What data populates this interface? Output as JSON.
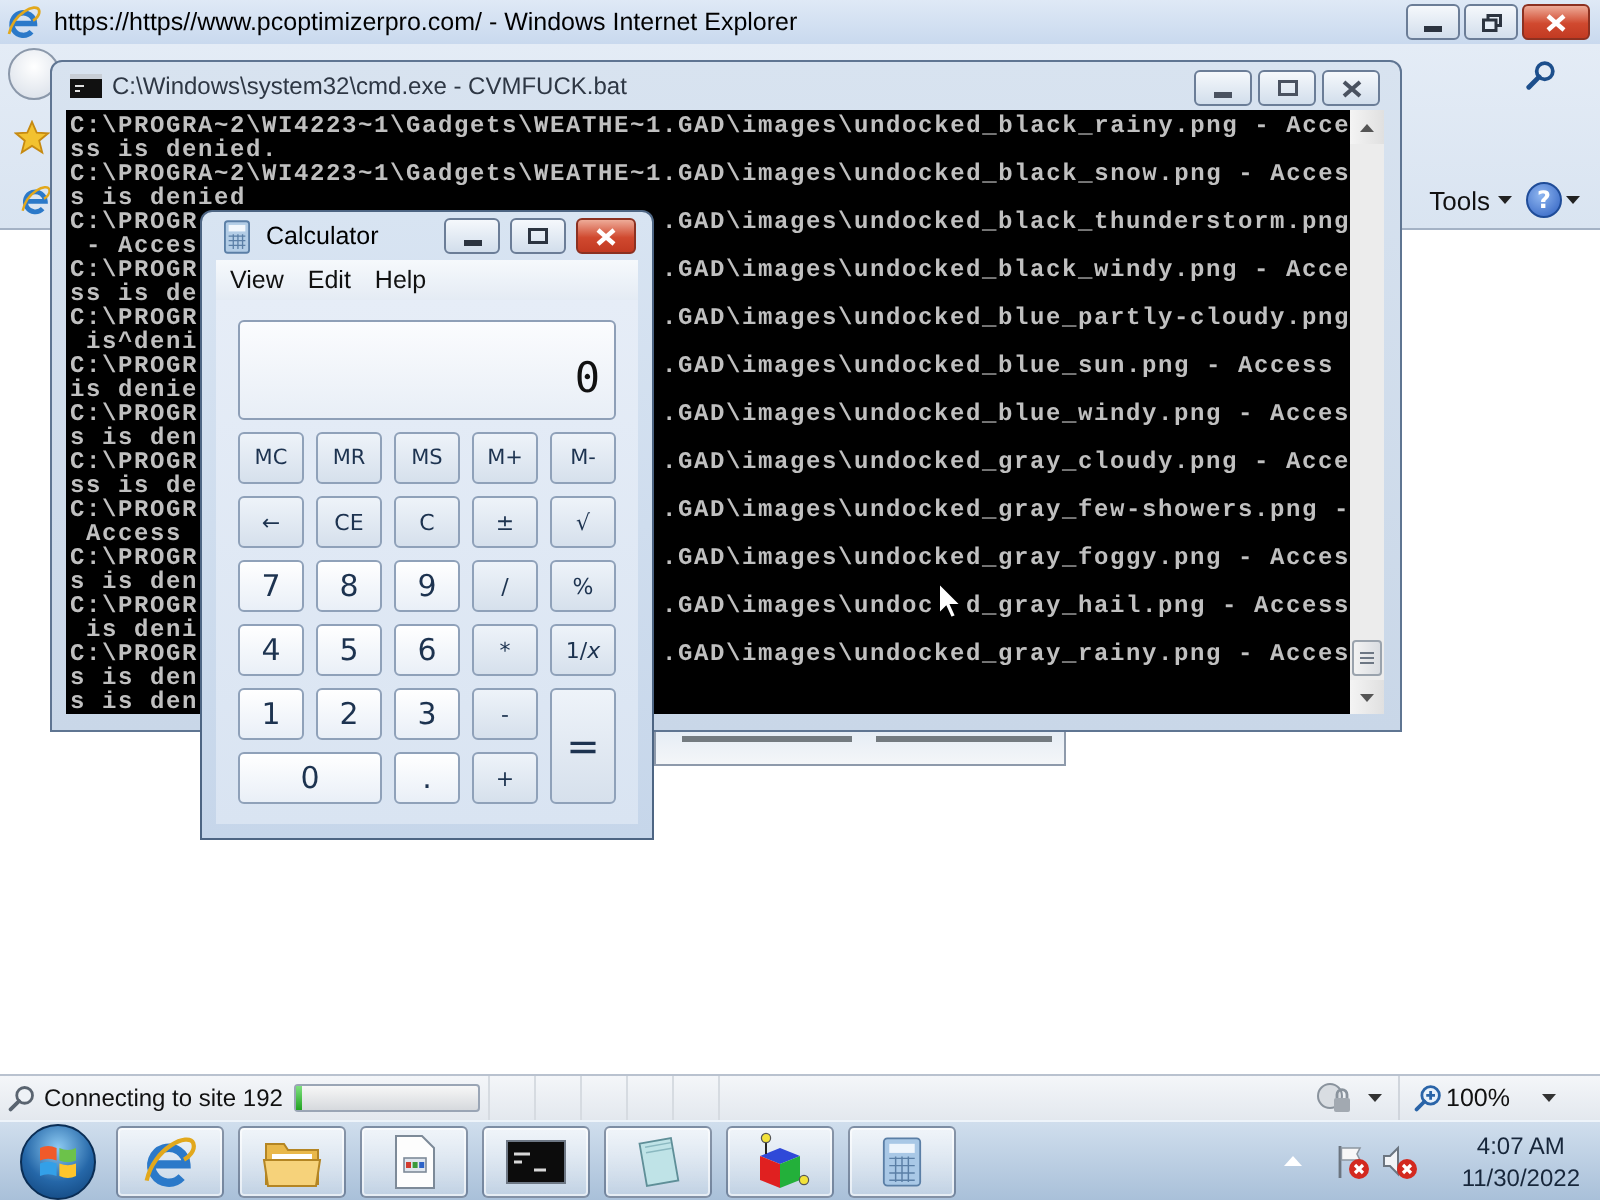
{
  "browser": {
    "title": "https://https//www.pcoptimizerpro.com/ - Windows Internet Explorer",
    "tools_menu": "Tools",
    "help": "?"
  },
  "console_window": {
    "title": "C:\\Windows\\system32\\cmd.exe - CVMFUCK.bat",
    "lines": [
      {
        "kind": "full",
        "text": "C:\\PROGRA~2\\WI4223~1\\Gadgets\\WEATHE~1.GAD\\images\\undocked_black_rainy.png - Acce"
      },
      {
        "kind": "full",
        "text": "ss is denied."
      },
      {
        "kind": "full",
        "text": "C:\\PROGRA~2\\WI4223~1\\Gadgets\\WEATHE~1.GAD\\images\\undocked_black_snow.png - Acces"
      },
      {
        "kind": "full",
        "text": "s is denied"
      },
      {
        "kind": "split",
        "left": "C:\\PROGR",
        "right": ".GAD\\images\\undocked_black_thunderstorm.png"
      },
      {
        "kind": "split",
        "left": " - Acces"
      },
      {
        "kind": "split",
        "left": "C:\\PROGR",
        "right": ".GAD\\images\\undocked_black_windy.png - Acce"
      },
      {
        "kind": "split",
        "left": "ss is de"
      },
      {
        "kind": "split",
        "left": "C:\\PROGR",
        "right": ".GAD\\images\\undocked_blue_partly-cloudy.png"
      },
      {
        "kind": "split",
        "left": " is^deni"
      },
      {
        "kind": "split",
        "left": "C:\\PROGR",
        "right": ".GAD\\images\\undocked_blue_sun.png - Access"
      },
      {
        "kind": "split",
        "left": "is denie"
      },
      {
        "kind": "split",
        "left": "C:\\PROGR",
        "right": ".GAD\\images\\undocked_blue_windy.png - Acces"
      },
      {
        "kind": "split",
        "left": "s is den"
      },
      {
        "kind": "split",
        "left": "C:\\PROGR",
        "right": ".GAD\\images\\undocked_gray_cloudy.png - Acce"
      },
      {
        "kind": "split",
        "left": "ss is de"
      },
      {
        "kind": "split",
        "left": "C:\\PROGR",
        "right": ".GAD\\images\\undocked_gray_few-showers.png -"
      },
      {
        "kind": "split",
        "left": " Access"
      },
      {
        "kind": "split",
        "left": "C:\\PROGR",
        "right": ".GAD\\images\\undocked_gray_foggy.png - Acces"
      },
      {
        "kind": "split",
        "left": "s is den"
      },
      {
        "kind": "split",
        "left": "C:\\PROGR",
        "right": ".GAD\\images\\undoc",
        "after_pointer": "d_gray_hail.png - Access"
      },
      {
        "kind": "split",
        "left": " is deni"
      },
      {
        "kind": "split",
        "left": "C:\\PROGR",
        "right": ".GAD\\images\\undocked_gray_rainy.png - Acces"
      },
      {
        "kind": "split",
        "left": "s is den"
      },
      {
        "kind": "split",
        "left": "s is den"
      }
    ]
  },
  "calculator": {
    "title": "Calculator",
    "menu": [
      "View",
      "Edit",
      "Help"
    ],
    "display": "0",
    "buttons": [
      {
        "label": "MC",
        "kind": "memory"
      },
      {
        "label": "MR",
        "kind": "memory"
      },
      {
        "label": "MS",
        "kind": "memory"
      },
      {
        "label": "M+",
        "kind": "memory"
      },
      {
        "label": "M-",
        "kind": "memory"
      },
      {
        "label": "←",
        "kind": "function"
      },
      {
        "label": "CE",
        "kind": "function"
      },
      {
        "label": "C",
        "kind": "function"
      },
      {
        "label": "±",
        "kind": "function"
      },
      {
        "label": "√",
        "kind": "function"
      },
      {
        "label": "7",
        "kind": "digit"
      },
      {
        "label": "8",
        "kind": "digit"
      },
      {
        "label": "9",
        "kind": "digit"
      },
      {
        "label": "/",
        "kind": "function"
      },
      {
        "label": "%",
        "kind": "function"
      },
      {
        "label": "4",
        "kind": "digit"
      },
      {
        "label": "5",
        "kind": "digit"
      },
      {
        "label": "6",
        "kind": "digit"
      },
      {
        "label": "*",
        "kind": "function"
      },
      {
        "label": "1/*x*",
        "kind": "function"
      },
      {
        "label": "1",
        "kind": "digit"
      },
      {
        "label": "2",
        "kind": "digit"
      },
      {
        "label": "3",
        "kind": "digit"
      },
      {
        "label": "-",
        "kind": "function"
      },
      {
        "label": "=",
        "kind": "equals"
      },
      {
        "label": "0",
        "kind": "zero"
      },
      {
        "label": ".",
        "kind": "digit"
      },
      {
        "label": "+",
        "kind": "function"
      }
    ]
  },
  "status_bar": {
    "text": "Connecting to site 192",
    "progress": {
      "level": 0.03
    },
    "zoom": "100%"
  },
  "taskbar": {
    "clock": {
      "time": "4:07 AM",
      "date": "11/30/2022"
    }
  }
}
